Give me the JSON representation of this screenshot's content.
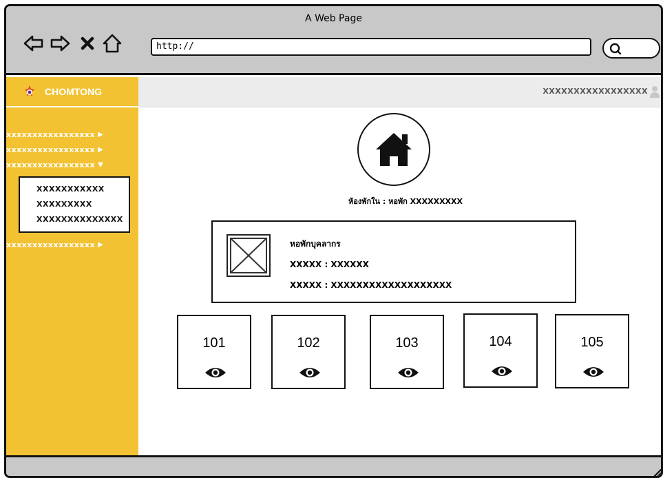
{
  "browser": {
    "title": "A Web Page",
    "url": "http://"
  },
  "sidebar": {
    "brand": "CHOMTONG",
    "items": [
      {
        "label": "xxxxxxxxxxxxxxxxx",
        "caret": "▶"
      },
      {
        "label": "xxxxxxxxxxxxxxxxx",
        "caret": "▶"
      },
      {
        "label": "xxxxxxxxxxxxxxxxx",
        "caret": "▼"
      },
      {
        "label": "xxxxxxxxxxxxxxxxx",
        "caret": "▶"
      }
    ],
    "submenu": [
      "XXXXXXXXXXX",
      "XXXXXXXXX",
      "XXXXXXXXXXXXXX"
    ],
    "accent_color": "#f2c232"
  },
  "topbar": {
    "user_label": "XXXXXXXXXXXXXXXXX"
  },
  "main": {
    "dorm_caption": "ห้องพักใน : หอพัก XXXXXXXXX",
    "info_card": {
      "line1": "หอพักบุคลากร",
      "line2": "XXXXX : XXXXXX",
      "line3": "XXXXX : XXXXXXXXXXXXXXXXXXX"
    },
    "rooms": [
      {
        "number": "101"
      },
      {
        "number": "102"
      },
      {
        "number": "103"
      },
      {
        "number": "104"
      },
      {
        "number": "105"
      }
    ]
  }
}
